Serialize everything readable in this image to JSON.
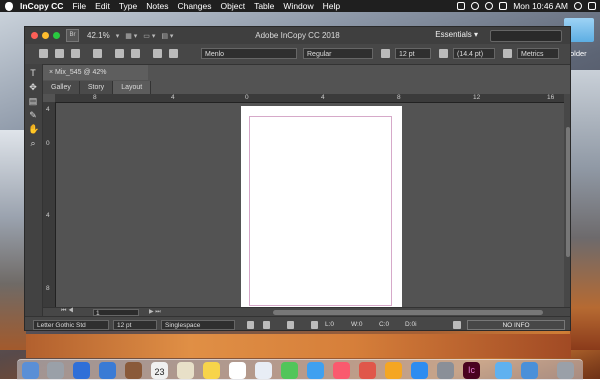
{
  "menubar": {
    "app_name": "InCopy CC",
    "items": [
      "File",
      "Edit",
      "Type",
      "Notes",
      "Changes",
      "Object",
      "Table",
      "Window",
      "Help"
    ],
    "clock": "Mon 10:46 AM"
  },
  "desktop": {
    "folder_label": "older"
  },
  "window": {
    "title": "Adobe InCopy CC 2018",
    "app_badge": "Br",
    "zoom": "42.1%",
    "workspace": "Essentials",
    "workspace_arrow": "▾",
    "control": {
      "font_family": "Menlo",
      "font_style": "Regular",
      "font_size": "12 pt",
      "leading": "(14.4 pt)",
      "kerning": "Metrics"
    },
    "doc_tab": "Mix_545 @ 42%",
    "views": [
      "Galley",
      "Story",
      "Layout"
    ],
    "ruler_h_labels": [
      "8",
      "4",
      "0",
      "4",
      "8",
      "12",
      "16"
    ],
    "ruler_v_labels": [
      "4",
      "0",
      "4",
      "8"
    ],
    "page_number": "1",
    "status": {
      "font": "Letter Gothic Std",
      "size": "12 pt",
      "spacing": "Singlespace",
      "lines": "L:0",
      "words": "W:0",
      "chars": "C:0",
      "depth": "D:0i",
      "info": "NO INFO"
    }
  },
  "dock": {
    "calendar_day": "23",
    "colors": [
      "#5a8fd6",
      "#9aa0a8",
      "#2f6fd8",
      "#3a7bd5",
      "#8a5a3a",
      "#f0f0f0",
      "#e8e0c8",
      "#f7d44a",
      "#ffffff",
      "#e8edf5",
      "#52c55a",
      "#3fa0f0",
      "#fa5a6e",
      "#e0574a",
      "#f5a623",
      "#2d8cf0",
      "#8a8f98",
      "#49021f",
      "#5fb1f0",
      "#4a90d9",
      "#9aa0a8"
    ]
  }
}
